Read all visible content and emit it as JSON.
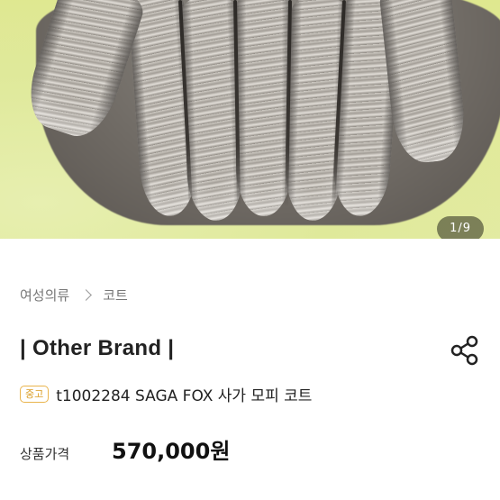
{
  "gallery": {
    "pager": "1/9"
  },
  "breadcrumb": {
    "category": "여성의류",
    "subcategory": "코트"
  },
  "product": {
    "brand": "| Other Brand |",
    "condition_badge": "중고",
    "title": "t1002284 SAGA FOX 사가 모피 코트",
    "price_label": "상품가격",
    "price": "570,000원"
  },
  "icons": {
    "share": "share-icon",
    "chevron": "chevron-right-icon"
  },
  "colors": {
    "badge": "#e9b44c",
    "background": "#ffffff"
  }
}
